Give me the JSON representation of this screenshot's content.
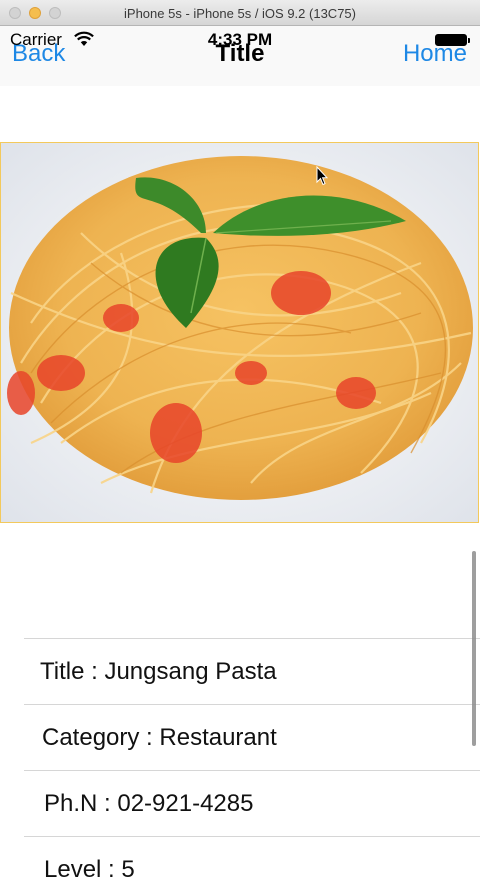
{
  "window": {
    "title": "iPhone 5s - iPhone 5s / iOS 9.2 (13C75)"
  },
  "status_bar": {
    "carrier": "Carrier",
    "time": "4:33 PM"
  },
  "nav": {
    "back_label": "Back",
    "title": "Title",
    "home_label": "Home",
    "accent_color": "#1e88e5"
  },
  "photo": {
    "subject": "spaghetti-with-tomato-and-basil"
  },
  "details": [
    {
      "label": "Title",
      "value": "Jungsang Pasta",
      "text": "Title : Jungsang Pasta"
    },
    {
      "label": "Category",
      "value": "Restaurant",
      "text": "Category : Restaurant"
    },
    {
      "label": "Ph.N",
      "value": "02-921-4285",
      "text": "Ph.N : 02-921-4285"
    },
    {
      "label": "Level",
      "value": "5",
      "text": "Level : 5"
    }
  ]
}
